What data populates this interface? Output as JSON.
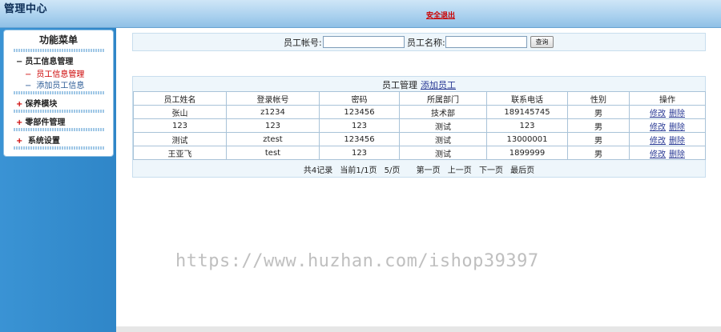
{
  "header": {
    "title": "管理中心",
    "logout_label": "安全退出"
  },
  "sidebar": {
    "title": "功能菜单",
    "groups": [
      {
        "mark": "−",
        "label": "员工信息管理"
      },
      {
        "mark": "+",
        "label": "保养模块"
      },
      {
        "mark": "+",
        "label": "零部件管理"
      },
      {
        "mark": "+",
        "label": " 系统设置"
      }
    ],
    "subitems": [
      {
        "dash": "−",
        "label": "员工信息管理"
      },
      {
        "dash": "−",
        "label": "添加员工信息"
      }
    ]
  },
  "search": {
    "account_label": "员工帐号:",
    "name_label": "员工名称:",
    "account_value": "",
    "name_value": "",
    "query_label": "查询"
  },
  "grid": {
    "caption": "员工管理",
    "add_label": "添加员工",
    "columns": [
      "员工姓名",
      "登录帐号",
      "密码",
      "所属部门",
      "联系电话",
      "性别",
      "操作"
    ],
    "rows": [
      [
        "张山",
        "z1234",
        "123456",
        "技术部",
        "189145745",
        "男"
      ],
      [
        "123",
        "123",
        "123",
        "测试",
        "123",
        "男"
      ],
      [
        "测试",
        "ztest",
        "123456",
        "测试",
        "13000001",
        "男"
      ],
      [
        "王亚飞",
        "test",
        "123",
        "测试",
        "1899999",
        "男"
      ]
    ],
    "edit_label": "修改",
    "delete_label": "删除"
  },
  "pager": {
    "total": "共4记录",
    "current": "当前1/1页",
    "per_page": "5/页",
    "first": "第一页",
    "prev": "上一页",
    "next": "下一页",
    "last": "最后页"
  },
  "watermark": "https://www.huzhan.com/ishop39397"
}
